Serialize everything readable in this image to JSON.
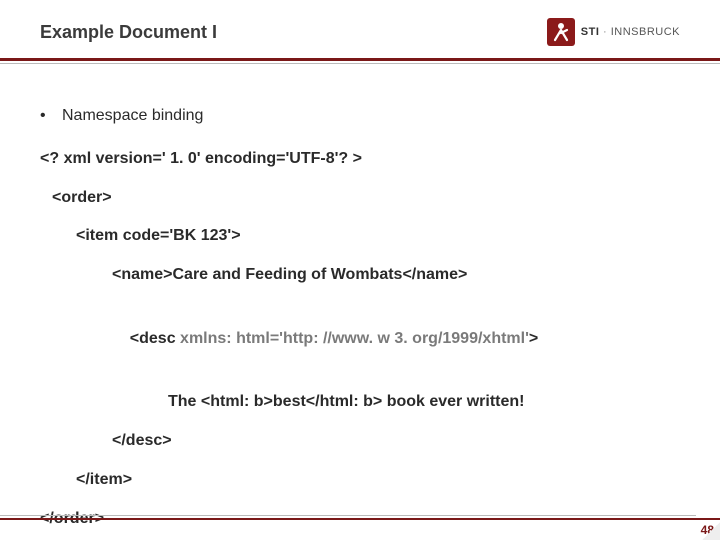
{
  "header": {
    "title": "Example Document I",
    "logo_brand": "STI",
    "logo_sep": " · ",
    "logo_sub": "INNSBRUCK"
  },
  "content": {
    "bullet": "Namespace binding",
    "lines": {
      "l1": "<? xml version=' 1. 0' encoding='UTF-8'? >",
      "l2": "<order>",
      "l3": "<item code='BK 123'>",
      "l4": "<name>Care and Feeding of Wombats</name>",
      "l5a": "<desc ",
      "l5b": "xmlns: html='http: //www. w 3. org/1999/xhtml'",
      "l5c": ">",
      "l6": "The <html: b>best</html: b> book ever written!",
      "l7": "</desc>",
      "l8": "</item>",
      "l9": "</order>"
    }
  },
  "footer": {
    "page": "48"
  }
}
